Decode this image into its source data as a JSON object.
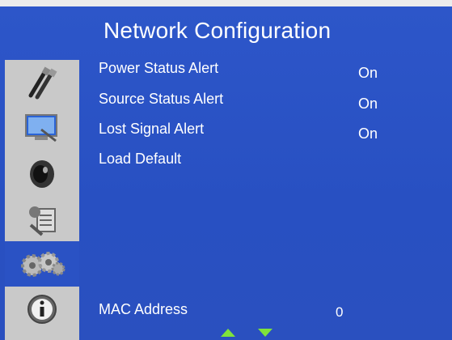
{
  "menu": {
    "title": "Network Configuration",
    "items": [
      {
        "label": "Power Status Alert",
        "value": "On"
      },
      {
        "label": "Source Status Alert",
        "value": "On"
      },
      {
        "label": "Lost Signal Alert",
        "value": "On"
      },
      {
        "label": "Load Default",
        "value": ""
      }
    ],
    "mac": {
      "label": "MAC Address",
      "value": "0"
    }
  },
  "sidebar": {
    "icons": [
      "cables-icon",
      "display-icon",
      "audio-speaker-icon",
      "settings-tools-icon",
      "network-gears-icon",
      "info-icon"
    ],
    "active_index": 4
  },
  "colors": {
    "background": "#2a52c4",
    "sidebar": "#c9c9c9",
    "text": "#ffffff",
    "nav_arrow": "#7fe33a"
  }
}
